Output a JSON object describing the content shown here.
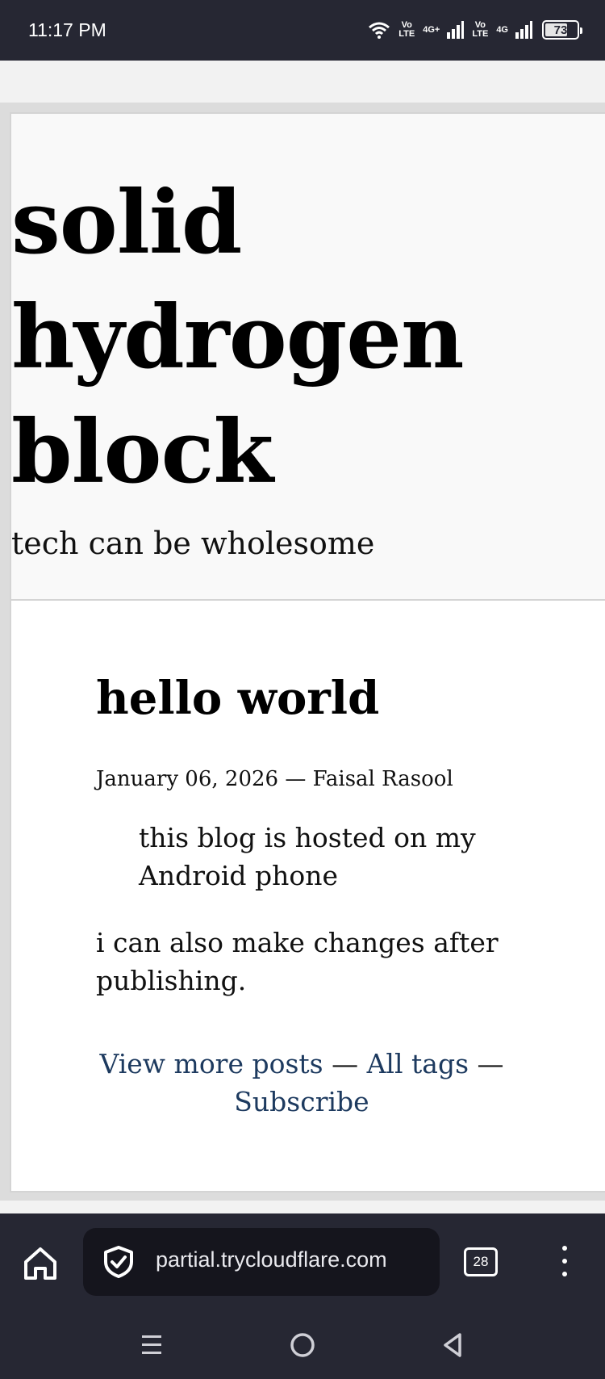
{
  "status_bar": {
    "time": "11:17 PM",
    "network1": "Vo LTE",
    "network1_gen": "4G+",
    "network2": "Vo LTE",
    "network2_gen": "4G",
    "battery": "73",
    "battery_level": 0.73
  },
  "site": {
    "title_line1": "solid",
    "title_line2": "hydrogen",
    "title_line3": "block",
    "tagline": "tech can be wholesome"
  },
  "post": {
    "title": "hello world",
    "meta": "January 06, 2026 — Faisal Rasool",
    "quote": "this blog is hosted on my Android phone",
    "body": "i can also make changes after publishing.",
    "links": {
      "view_more": "View more posts",
      "sep1": " — ",
      "all_tags": "All tags",
      "sep2": " —",
      "subscribe": "Subscribe"
    }
  },
  "browser": {
    "url": "partial.trycloudflare.com",
    "tab_count": "28",
    "icons": {
      "home": "home-icon",
      "security": "shield-check-icon",
      "menu": "more-vertical-icon"
    }
  },
  "nav": {
    "icons": [
      "recents-icon",
      "home-circle-icon",
      "back-icon"
    ]
  },
  "colors": {
    "status_bg": "#262733",
    "link": "#1d3a5f",
    "header_bg": "#f9f9f9",
    "card_bg": "#ffffff"
  }
}
